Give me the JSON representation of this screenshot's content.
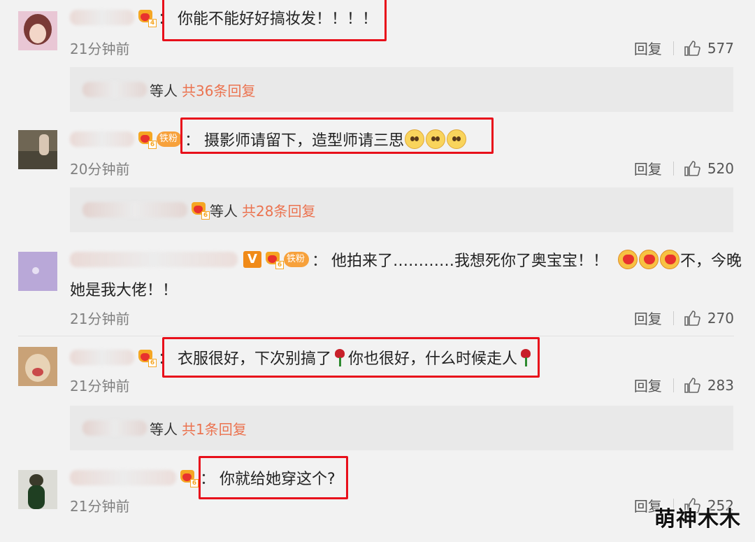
{
  "comments": [
    {
      "text": "你能不能好好搞妆发！！！！",
      "time": "21分钟前",
      "reply_label": "回复",
      "likes": "577",
      "badges": {
        "vip_level": "4"
      },
      "sub_replies": {
        "etc": "等人",
        "total": "共36条回复"
      }
    },
    {
      "text": "摄影师请留下，造型师请三思",
      "emojis": [
        "sad-face",
        "sad-face",
        "sad-face"
      ],
      "time": "20分钟前",
      "reply_label": "回复",
      "likes": "520",
      "badges": {
        "vip_level": "6",
        "fan": "铁粉"
      },
      "sub_replies": {
        "etc": "等人",
        "total": "共28条回复",
        "vip_level": "6"
      }
    },
    {
      "text_a": "他拍来了…………我想死你了奥宝宝！！",
      "text_b": "不，今晚",
      "text_c": "她是我大佬！！",
      "emojis": [
        "kiss-face",
        "kiss-face",
        "kiss-face"
      ],
      "time": "21分钟前",
      "reply_label": "回复",
      "likes": "270",
      "badges": {
        "v": "V",
        "vip_level": "6",
        "fan": "铁粉"
      }
    },
    {
      "text_a": "衣服很好，下次别搞了",
      "text_b": "你也很好，什么时候走人",
      "emojis": [
        "rose",
        "rose"
      ],
      "time": "21分钟前",
      "reply_label": "回复",
      "likes": "283",
      "badges": {
        "vip_level": "6"
      },
      "sub_replies": {
        "etc": "等人",
        "total": "共1条回复"
      }
    },
    {
      "text": "你就给她穿这个?",
      "time": "21分钟前",
      "reply_label": "回复",
      "likes": "252",
      "badges": {
        "vip_level": "6"
      }
    }
  ],
  "colon": "：",
  "watermark": "萌神木木",
  "colors": {
    "highlight_box": "#e8101b",
    "link_orange": "#eb7350",
    "fan_badge": "#f7a13b"
  }
}
